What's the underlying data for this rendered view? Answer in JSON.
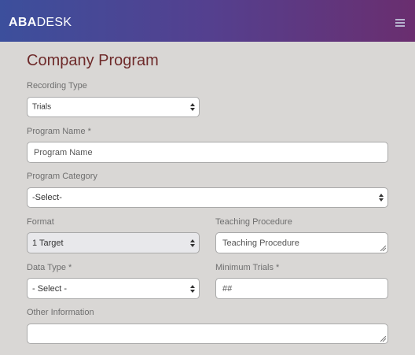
{
  "nav": {
    "brand_bold": "ABA",
    "brand_light": "DESK"
  },
  "page": {
    "title": "Company Program"
  },
  "form": {
    "recording_type": {
      "label": "Recording Type",
      "value": "Trials"
    },
    "program_name": {
      "label": "Program Name *",
      "placeholder": "Program Name"
    },
    "program_category": {
      "label": "Program Category",
      "value": "-Select-"
    },
    "format": {
      "label": "Format",
      "value": "1 Target"
    },
    "teaching_procedure": {
      "label": "Teaching Procedure",
      "placeholder": "Teaching Procedure"
    },
    "data_type": {
      "label": "Data Type *",
      "value": "- Select -"
    },
    "minimum_trials": {
      "label": "Minimum Trials *",
      "placeholder": "##"
    },
    "other_information": {
      "label": "Other Information",
      "placeholder": ""
    }
  },
  "colors": {
    "nav_gradient_start": "#3c4f9c",
    "nav_gradient_end": "#6a2e6f",
    "title_color": "#6e2a2a",
    "page_bg": "#d9d7d5"
  },
  "icons": {
    "menu": "hamburger-menu-icon",
    "select": "select-arrows-icon",
    "resize": "resize-grip-icon"
  }
}
